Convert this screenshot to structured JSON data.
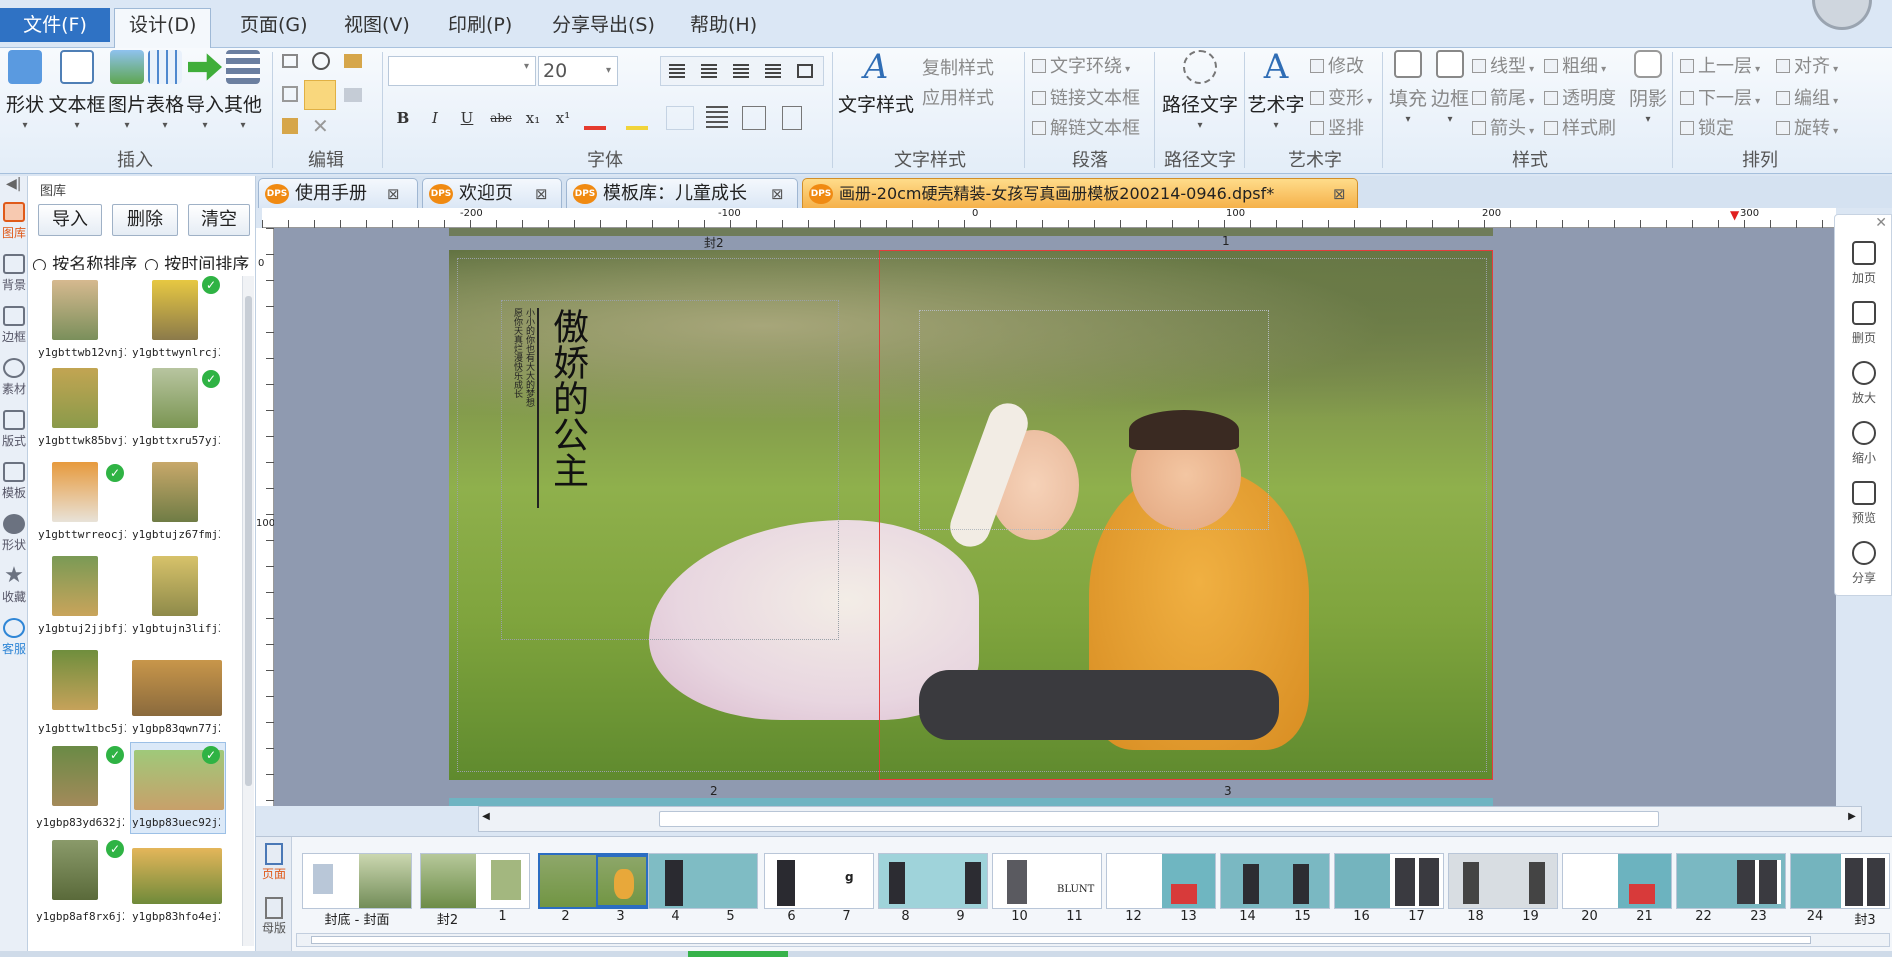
{
  "menu": {
    "file": "文件(F)",
    "design": "设计(D)",
    "page": "页面(G)",
    "view": "视图(V)",
    "print": "印刷(P)",
    "share": "分享导出(S)",
    "help": "帮助(H)"
  },
  "ribbon": {
    "insert": {
      "label": "插入",
      "shape": "形状",
      "textbox": "文本框",
      "image": "图片",
      "table": "表格",
      "import": "导入",
      "other": "其他"
    },
    "edit": {
      "label": "编辑"
    },
    "font": {
      "label": "字体",
      "size": "20",
      "bold": "B",
      "italic": "I",
      "underline": "U",
      "strike": "abc",
      "sub": "x₁",
      "sup": "x¹"
    },
    "textstyle": {
      "label": "文字样式",
      "big": "文字样式",
      "copy": "复制样式",
      "apply": "应用样式"
    },
    "paragraph": {
      "label": "段落",
      "wrap": "文字环绕",
      "link": "链接文本框",
      "unlink": "解链文本框"
    },
    "pathtext": {
      "label": "路径文字",
      "big": "路径文字"
    },
    "arttext": {
      "label": "艺术字",
      "big": "艺术字",
      "modify": "修改",
      "transform": "变形",
      "vertical": "竖排"
    },
    "style": {
      "label": "样式",
      "fill": "填充",
      "border": "边框",
      "linetype": "线型",
      "weight": "粗细",
      "cap": "箭尾",
      "opacity": "透明度",
      "arrow": "箭头",
      "brush": "样式刷",
      "shadow": "阴影"
    },
    "arrange": {
      "label": "排列",
      "up": "上一层",
      "align": "对齐",
      "down": "下一层",
      "group": "编组",
      "lock": "锁定",
      "rotate": "旋转"
    }
  },
  "rail": [
    "图库",
    "背景",
    "边框",
    "素材",
    "版式",
    "模板",
    "形状",
    "收藏",
    "客服"
  ],
  "panel": {
    "title": "图库",
    "import": "导入",
    "delete": "删除",
    "clear": "清空",
    "sort_name": "按名称排序",
    "sort_time": "按时间排序",
    "images": [
      "y1gbttwb12vnj3",
      "y1gbttwynlrcj3",
      "y1gbttwk85bvj3",
      "y1gbttxru57yj3",
      "y1gbttwrreocj3",
      "y1gbtujz67fmj3",
      "y1gbtuj2jjbfj3",
      "y1gbtujn3lifj3",
      "y1gbttw1tbc5j3",
      "y1gbp83qwn77j2",
      "y1gbp83yd632j2",
      "y1gbp83uec92j2",
      "y1gbp8af8rx6j2",
      "y1gbp83hfo4ej2"
    ]
  },
  "tabs": [
    "使用手册",
    "欢迎页",
    "模板库：儿童成长",
    "画册-20cm硬壳精装-女孩写真画册模板200214-0946.dpsf*"
  ],
  "tab_badge": "DPS",
  "ruler": {
    "h": [
      "-200",
      "-100",
      "0",
      "100",
      "200",
      "300"
    ],
    "v": [
      "0",
      "100"
    ]
  },
  "canvas": {
    "top_label": "封2",
    "top_num": "1",
    "bottom_left": "2",
    "bottom_right": "3",
    "title_text": "傲娇的公主",
    "subtitle_text": "小小的你也有大大的梦想",
    "subtitle2_text": "愿你天真烂漫快乐成长"
  },
  "right_toolbar": [
    "加页",
    "删页",
    "放大",
    "缩小",
    "预览",
    "分享"
  ],
  "filmstrip": {
    "side_tabs": [
      "页面",
      "母版"
    ],
    "pages": [
      "封底 - 封面",
      "封2",
      "1",
      "2",
      "3",
      "4",
      "5",
      "6",
      "7",
      "8",
      "9",
      "10",
      "11",
      "12",
      "13",
      "14",
      "15",
      "16",
      "17",
      "18",
      "19",
      "20",
      "21",
      "22",
      "23",
      "24",
      "封3"
    ],
    "brand_text": "BLUNT"
  }
}
